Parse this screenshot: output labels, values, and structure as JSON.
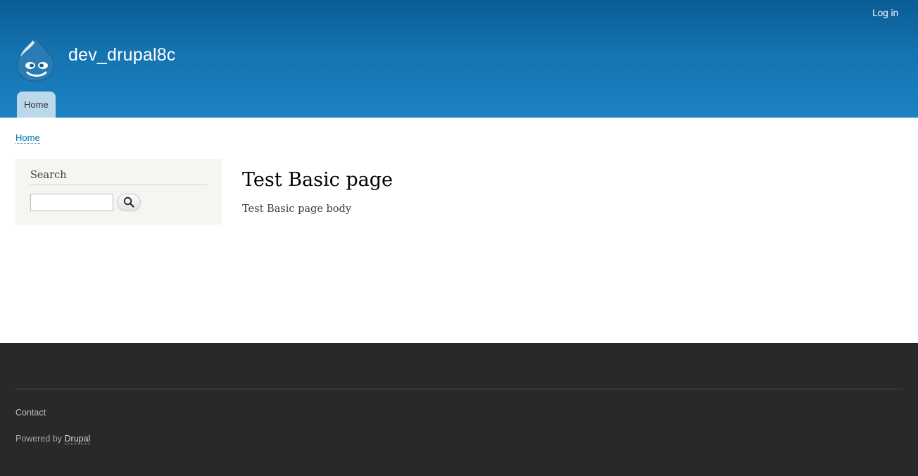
{
  "header": {
    "login_label": "Log in",
    "site_name": "dev_drupal8c",
    "logo_icon": "drupal-drop-logo",
    "nav": [
      {
        "label": "Home",
        "active": true
      }
    ]
  },
  "breadcrumb": {
    "items": [
      "Home"
    ]
  },
  "sidebar": {
    "search_block": {
      "title": "Search",
      "input_value": "",
      "button_icon": "search-icon"
    }
  },
  "main": {
    "title": "Test Basic page",
    "body": "Test Basic page body"
  },
  "footer": {
    "contact_label": "Contact",
    "powered_by_prefix": "Powered by",
    "powered_by_link": "Drupal"
  },
  "colors": {
    "header_top": "#0a5c94",
    "header_bottom": "#1b83c4",
    "nav_tab": "#bcd9ec",
    "link": "#0071b3",
    "sidebar_bg": "#f5f5f1",
    "footer_bg": "#292929"
  }
}
